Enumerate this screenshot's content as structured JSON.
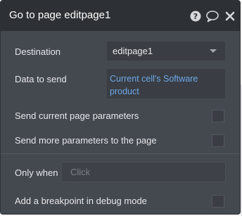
{
  "header": {
    "title": "Go to page editpage1",
    "icons": [
      "help-icon",
      "comment-icon",
      "close-icon"
    ]
  },
  "destination": {
    "label": "Destination",
    "selected": "editpage1"
  },
  "data_to_send": {
    "label": "Data to send",
    "expression": "Current cell's Software product"
  },
  "options": {
    "send_current_params_label": "Send current page parameters",
    "send_current_params_checked": false,
    "send_more_params_label": "Send more parameters to the page",
    "send_more_params_checked": false
  },
  "only_when": {
    "label": "Only when",
    "placeholder": "Click"
  },
  "debug": {
    "breakpoint_label": "Add a breakpoint in debug mode",
    "breakpoint_checked": false
  },
  "colors": {
    "panel_bg": "#444950",
    "header_bg": "#2d3136",
    "expression_text": "#6ca7e8",
    "label_text": "#e6e7e9"
  }
}
